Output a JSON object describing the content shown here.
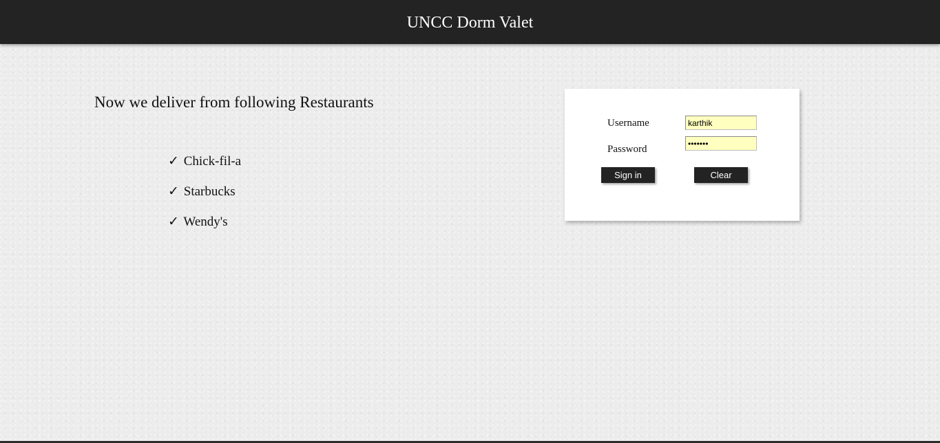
{
  "header": {
    "title": "UNCC Dorm Valet"
  },
  "promo": {
    "heading": "Now we deliver from following Restaurants",
    "check_glyph": "✓",
    "restaurants": [
      {
        "name": "Chick-fil-a"
      },
      {
        "name": "Starbucks"
      },
      {
        "name": "Wendy's"
      }
    ]
  },
  "login": {
    "username_label": "Username",
    "username_value": "karthik",
    "password_label": "Password",
    "password_value": "•••••••",
    "signin_label": "Sign in",
    "clear_label": "Clear"
  },
  "colors": {
    "header_bg": "#232323",
    "button_bg": "#232323",
    "input_bg": "#ffffc0",
    "page_bg": "#ececec"
  }
}
